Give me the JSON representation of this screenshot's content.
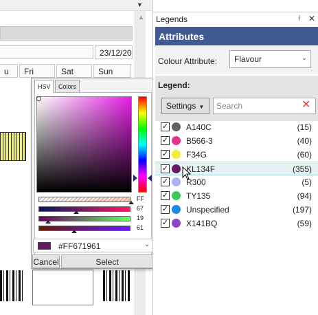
{
  "calendar": {
    "date": "23/12/20",
    "days": [
      "u",
      "Fri",
      "Sat",
      "Sun"
    ]
  },
  "picker": {
    "tabs": [
      "HSV",
      "Colors"
    ],
    "values": {
      "alpha": "FF",
      "red": "67",
      "green": "19",
      "blue": "61"
    },
    "levels": {
      "alpha": 1.0,
      "red": 0.404,
      "green": 0.098,
      "blue": 0.38
    },
    "hex": "#FF671961",
    "swatch_color": "#671961",
    "cancel_label": "Cancel",
    "select_label": "Select"
  },
  "legends": {
    "title": "Legends",
    "attributes_heading": "Attributes",
    "colour_attribute_label": "Colour Attribute:",
    "colour_attribute_value": "Flavour",
    "legend_label": "Legend:",
    "settings_label": "Settings",
    "search_placeholder": "Search",
    "items": [
      {
        "name": "A140C",
        "count": "(15)",
        "color": "#5f6266",
        "checked": true
      },
      {
        "name": "B566-3",
        "count": "(40)",
        "color": "#e8338f",
        "checked": true
      },
      {
        "name": "F34G",
        "count": "(60)",
        "color": "#f3ee3a",
        "checked": true
      },
      {
        "name": "KL134F",
        "count": "(355)",
        "color": "#671961",
        "checked": true,
        "selected": true
      },
      {
        "name": "R300",
        "count": "(5)",
        "color": "#a9b4f0",
        "checked": true
      },
      {
        "name": "TY135",
        "count": "(94)",
        "color": "#3cc95a",
        "checked": true
      },
      {
        "name": "Unspecified",
        "count": "(197)",
        "color": "#1e88e5",
        "checked": true
      },
      {
        "name": "X141BQ",
        "count": "(59)",
        "color": "#8e44c9",
        "checked": true
      }
    ]
  }
}
